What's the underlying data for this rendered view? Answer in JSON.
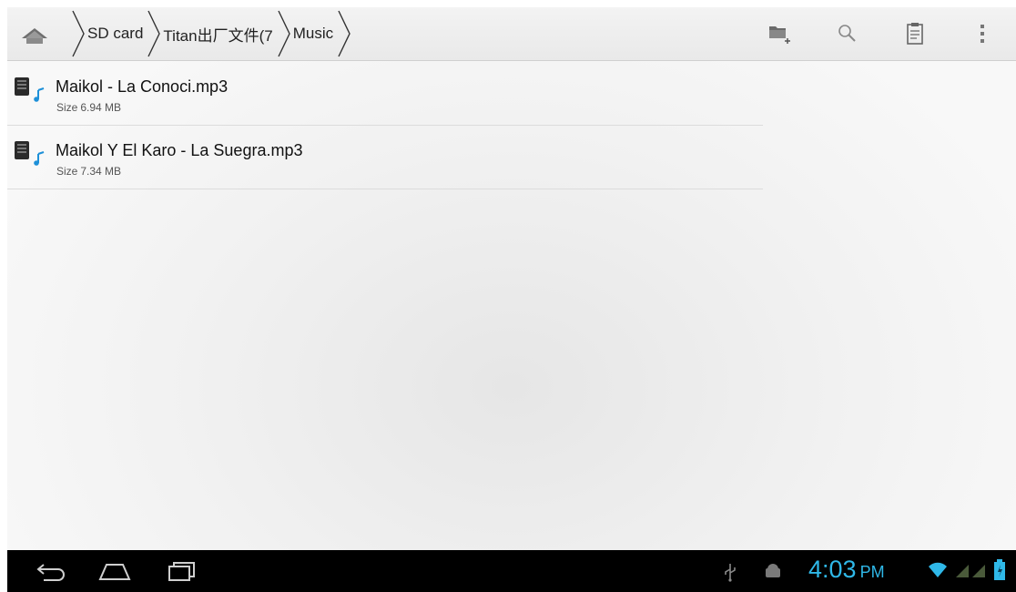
{
  "breadcrumbs": [
    {
      "label": "SD card"
    },
    {
      "label": "Titan出厂文件(7"
    },
    {
      "label": "Music"
    }
  ],
  "actions": [
    {
      "icon": "new-folder-icon"
    },
    {
      "icon": "search-icon"
    },
    {
      "icon": "clipboard-icon"
    },
    {
      "icon": "overflow-menu-icon"
    }
  ],
  "files": [
    {
      "name": "Maikol - La Conoci.mp3",
      "size_label": "Size",
      "size": "6.94 MB"
    },
    {
      "name": "Maikol Y El Karo - La Suegra.mp3",
      "size_label": "Size",
      "size": "7.34 MB"
    }
  ],
  "status": {
    "time": "4:03",
    "ampm": "PM",
    "accent_color": "#2fb8e8"
  },
  "colors": {
    "system_bar": "#000000",
    "divider": "#dcdcdc"
  }
}
